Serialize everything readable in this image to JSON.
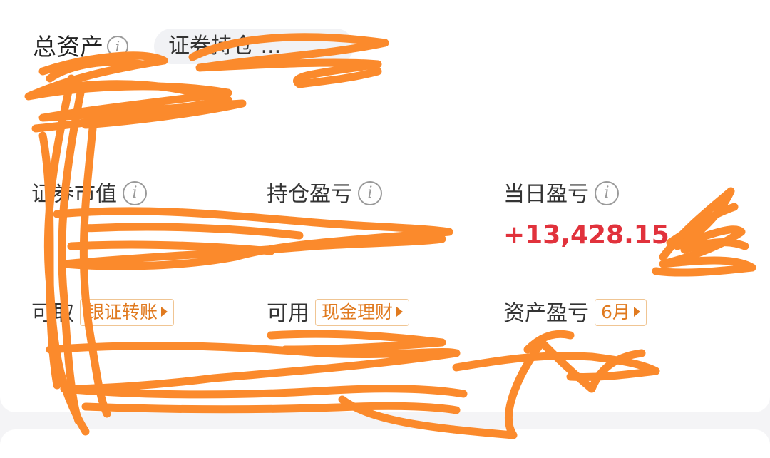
{
  "summary": {
    "total_assets_label": "总资产",
    "account_pill_text": "证券持仓 ...",
    "total_assets_value": ""
  },
  "stats": {
    "market_value": {
      "label": "证券市值",
      "value": ""
    },
    "position_pnl": {
      "label": "持仓盈亏",
      "value": ""
    },
    "daily_pnl": {
      "label": "当日盈亏",
      "value": "+13,428.15"
    },
    "withdrawable": {
      "label": "可取",
      "tag": "银证转账",
      "value": ""
    },
    "available": {
      "label": "可用",
      "tag": "现金理财",
      "value": ""
    },
    "asset_pnl": {
      "label": "资产盈亏",
      "tag": "6月",
      "value": ""
    }
  },
  "colors": {
    "positive": "#e1323c",
    "tag_orange": "#e07a1f",
    "redaction": "#fb8a2c"
  }
}
